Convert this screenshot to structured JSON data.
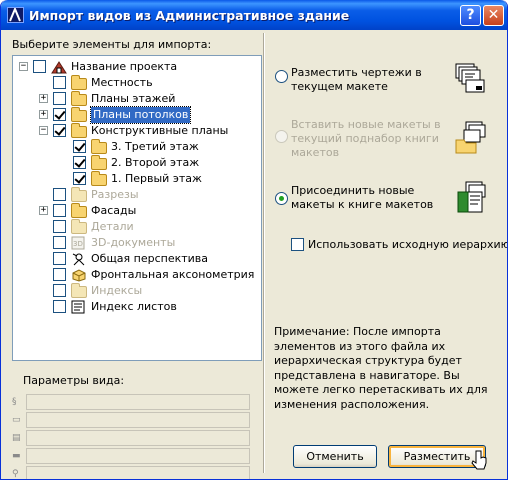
{
  "window": {
    "title": "Импорт видов из Административное здание",
    "help_label": "?",
    "close_label": "✕"
  },
  "left": {
    "select_label": "Выберите элементы для импорта:",
    "tree": [
      {
        "label": "Название проекта",
        "level": 0,
        "expander": "minus",
        "checked": false,
        "icon": "project-icon",
        "disabled": false
      },
      {
        "label": "Местность",
        "level": 1,
        "expander": "",
        "checked": false,
        "icon": "folder-icon",
        "disabled": false
      },
      {
        "label": "Планы этажей",
        "level": 1,
        "expander": "plus",
        "checked": false,
        "icon": "folder-icon",
        "disabled": false
      },
      {
        "label": "Планы потолков",
        "level": 1,
        "expander": "plus",
        "checked": true,
        "icon": "folder-icon",
        "disabled": false,
        "selected": true
      },
      {
        "label": "Конструктивные планы",
        "level": 1,
        "expander": "minus",
        "checked": true,
        "icon": "folder-icon",
        "disabled": false
      },
      {
        "label": "3. Третий этаж",
        "level": 2,
        "expander": "",
        "checked": true,
        "icon": "folder-icon",
        "disabled": false
      },
      {
        "label": "2. Второй этаж",
        "level": 2,
        "expander": "",
        "checked": true,
        "icon": "folder-icon",
        "disabled": false
      },
      {
        "label": "1. Первый этаж",
        "level": 2,
        "expander": "",
        "checked": true,
        "icon": "folder-icon",
        "disabled": false
      },
      {
        "label": "Разрезы",
        "level": 1,
        "expander": "",
        "checked": false,
        "icon": "folder-icon",
        "disabled": true
      },
      {
        "label": "Фасады",
        "level": 1,
        "expander": "plus",
        "checked": false,
        "icon": "folder-icon",
        "disabled": false
      },
      {
        "label": "Детали",
        "level": 1,
        "expander": "",
        "checked": false,
        "icon": "folder-icon",
        "disabled": true
      },
      {
        "label": "3D-документы",
        "level": 1,
        "expander": "",
        "checked": false,
        "icon": "3d-document-icon",
        "disabled": true
      },
      {
        "label": "Общая перспектива",
        "level": 1,
        "expander": "",
        "checked": false,
        "icon": "camera-icon",
        "disabled": false
      },
      {
        "label": "Фронтальная аксонометрия",
        "level": 1,
        "expander": "",
        "checked": false,
        "icon": "axonometry-icon",
        "disabled": false
      },
      {
        "label": "Индексы",
        "level": 1,
        "expander": "",
        "checked": false,
        "icon": "folder-icon",
        "disabled": true
      },
      {
        "label": "Индекс листов",
        "level": 1,
        "expander": "",
        "checked": false,
        "icon": "sheet-index-icon",
        "disabled": false
      }
    ],
    "view_params_label": "Параметры вида:",
    "view_params_fields": [
      {
        "icon": "id-icon",
        "value": ""
      },
      {
        "icon": "name-icon",
        "value": ""
      },
      {
        "icon": "layer-icon",
        "value": ""
      },
      {
        "icon": "scale-icon",
        "value": ""
      },
      {
        "icon": "zoom-icon",
        "value": ""
      }
    ]
  },
  "right": {
    "option_place_drawings": "Разместить чертежи в текущем макете",
    "option_insert_layouts": "Вставить новые макеты в текущий поднабор книги макетов",
    "option_attach_layouts": "Присоединить новые макеты к книге макетов",
    "selected_option": "attach",
    "keep_hierarchy_label": "Использовать исходную иерархию",
    "keep_hierarchy_checked": false,
    "note": "Примечание: После импорта элементов из этого файла их иерархическая структура будет представлена в навигаторе. Вы можете легко перетаскивать их для изменения расположения.",
    "cancel_label": "Отменить",
    "place_label": "Разместить"
  }
}
